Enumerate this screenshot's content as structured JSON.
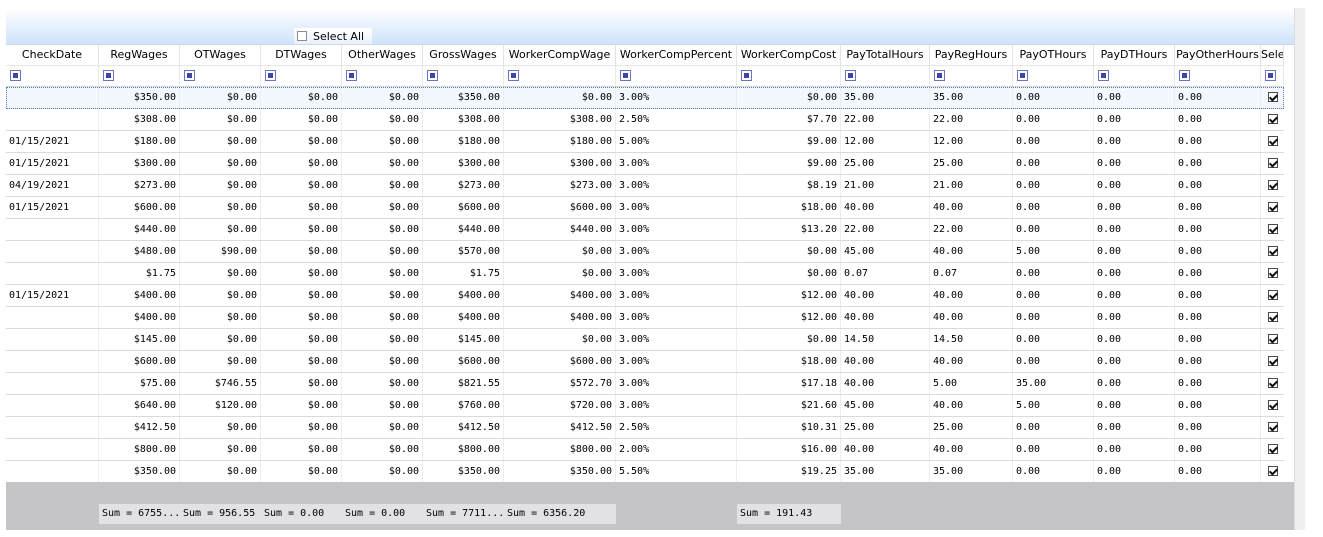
{
  "select_all_label": "Select All",
  "columns": [
    "CheckDate",
    "RegWages",
    "OTWages",
    "DTWages",
    "OtherWages",
    "GrossWages",
    "WorkerCompWage",
    "WorkerCompPercent",
    "WorkerCompCost",
    "PayTotalHours",
    "PayRegHours",
    "PayOTHours",
    "PayDTHours",
    "PayOtherHours",
    "Sele"
  ],
  "rows": [
    [
      "",
      "$350.00",
      "$0.00",
      "$0.00",
      "$0.00",
      "$350.00",
      "$0.00",
      "3.00%",
      "$0.00",
      "35.00",
      "35.00",
      "0.00",
      "0.00",
      "0.00"
    ],
    [
      "",
      "$308.00",
      "$0.00",
      "$0.00",
      "$0.00",
      "$308.00",
      "$308.00",
      "2.50%",
      "$7.70",
      "22.00",
      "22.00",
      "0.00",
      "0.00",
      "0.00"
    ],
    [
      "01/15/2021",
      "$180.00",
      "$0.00",
      "$0.00",
      "$0.00",
      "$180.00",
      "$180.00",
      "5.00%",
      "$9.00",
      "12.00",
      "12.00",
      "0.00",
      "0.00",
      "0.00"
    ],
    [
      "01/15/2021",
      "$300.00",
      "$0.00",
      "$0.00",
      "$0.00",
      "$300.00",
      "$300.00",
      "3.00%",
      "$9.00",
      "25.00",
      "25.00",
      "0.00",
      "0.00",
      "0.00"
    ],
    [
      "04/19/2021",
      "$273.00",
      "$0.00",
      "$0.00",
      "$0.00",
      "$273.00",
      "$273.00",
      "3.00%",
      "$8.19",
      "21.00",
      "21.00",
      "0.00",
      "0.00",
      "0.00"
    ],
    [
      "01/15/2021",
      "$600.00",
      "$0.00",
      "$0.00",
      "$0.00",
      "$600.00",
      "$600.00",
      "3.00%",
      "$18.00",
      "40.00",
      "40.00",
      "0.00",
      "0.00",
      "0.00"
    ],
    [
      "",
      "$440.00",
      "$0.00",
      "$0.00",
      "$0.00",
      "$440.00",
      "$440.00",
      "3.00%",
      "$13.20",
      "22.00",
      "22.00",
      "0.00",
      "0.00",
      "0.00"
    ],
    [
      "",
      "$480.00",
      "$90.00",
      "$0.00",
      "$0.00",
      "$570.00",
      "$0.00",
      "3.00%",
      "$0.00",
      "45.00",
      "40.00",
      "5.00",
      "0.00",
      "0.00"
    ],
    [
      "",
      "$1.75",
      "$0.00",
      "$0.00",
      "$0.00",
      "$1.75",
      "$0.00",
      "3.00%",
      "$0.00",
      "0.07",
      "0.07",
      "0.00",
      "0.00",
      "0.00"
    ],
    [
      "01/15/2021",
      "$400.00",
      "$0.00",
      "$0.00",
      "$0.00",
      "$400.00",
      "$400.00",
      "3.00%",
      "$12.00",
      "40.00",
      "40.00",
      "0.00",
      "0.00",
      "0.00"
    ],
    [
      "",
      "$400.00",
      "$0.00",
      "$0.00",
      "$0.00",
      "$400.00",
      "$400.00",
      "3.00%",
      "$12.00",
      "40.00",
      "40.00",
      "0.00",
      "0.00",
      "0.00"
    ],
    [
      "",
      "$145.00",
      "$0.00",
      "$0.00",
      "$0.00",
      "$145.00",
      "$0.00",
      "3.00%",
      "$0.00",
      "14.50",
      "14.50",
      "0.00",
      "0.00",
      "0.00"
    ],
    [
      "",
      "$600.00",
      "$0.00",
      "$0.00",
      "$0.00",
      "$600.00",
      "$600.00",
      "3.00%",
      "$18.00",
      "40.00",
      "40.00",
      "0.00",
      "0.00",
      "0.00"
    ],
    [
      "",
      "$75.00",
      "$746.55",
      "$0.00",
      "$0.00",
      "$821.55",
      "$572.70",
      "3.00%",
      "$17.18",
      "40.00",
      "5.00",
      "35.00",
      "0.00",
      "0.00"
    ],
    [
      "",
      "$640.00",
      "$120.00",
      "$0.00",
      "$0.00",
      "$760.00",
      "$720.00",
      "3.00%",
      "$21.60",
      "45.00",
      "40.00",
      "5.00",
      "0.00",
      "0.00"
    ],
    [
      "",
      "$412.50",
      "$0.00",
      "$0.00",
      "$0.00",
      "$412.50",
      "$412.50",
      "2.50%",
      "$10.31",
      "25.00",
      "25.00",
      "0.00",
      "0.00",
      "0.00"
    ],
    [
      "",
      "$800.00",
      "$0.00",
      "$0.00",
      "$0.00",
      "$800.00",
      "$800.00",
      "2.00%",
      "$16.00",
      "40.00",
      "40.00",
      "0.00",
      "0.00",
      "0.00"
    ],
    [
      "",
      "$350.00",
      "$0.00",
      "$0.00",
      "$0.00",
      "$350.00",
      "$350.00",
      "5.50%",
      "$19.25",
      "35.00",
      "35.00",
      "0.00",
      "0.00",
      "0.00"
    ]
  ],
  "summaries": [
    {
      "col": 1,
      "text": "Sum = 6755...."
    },
    {
      "col": 2,
      "text": "Sum = 956.55"
    },
    {
      "col": 3,
      "text": "Sum = 0.00"
    },
    {
      "col": 4,
      "text": "Sum = 0.00"
    },
    {
      "col": 5,
      "text": "Sum = 7711...."
    },
    {
      "col": 6,
      "text": "Sum = 6356.20"
    },
    {
      "col": 8,
      "text": "Sum = 191.43"
    }
  ]
}
